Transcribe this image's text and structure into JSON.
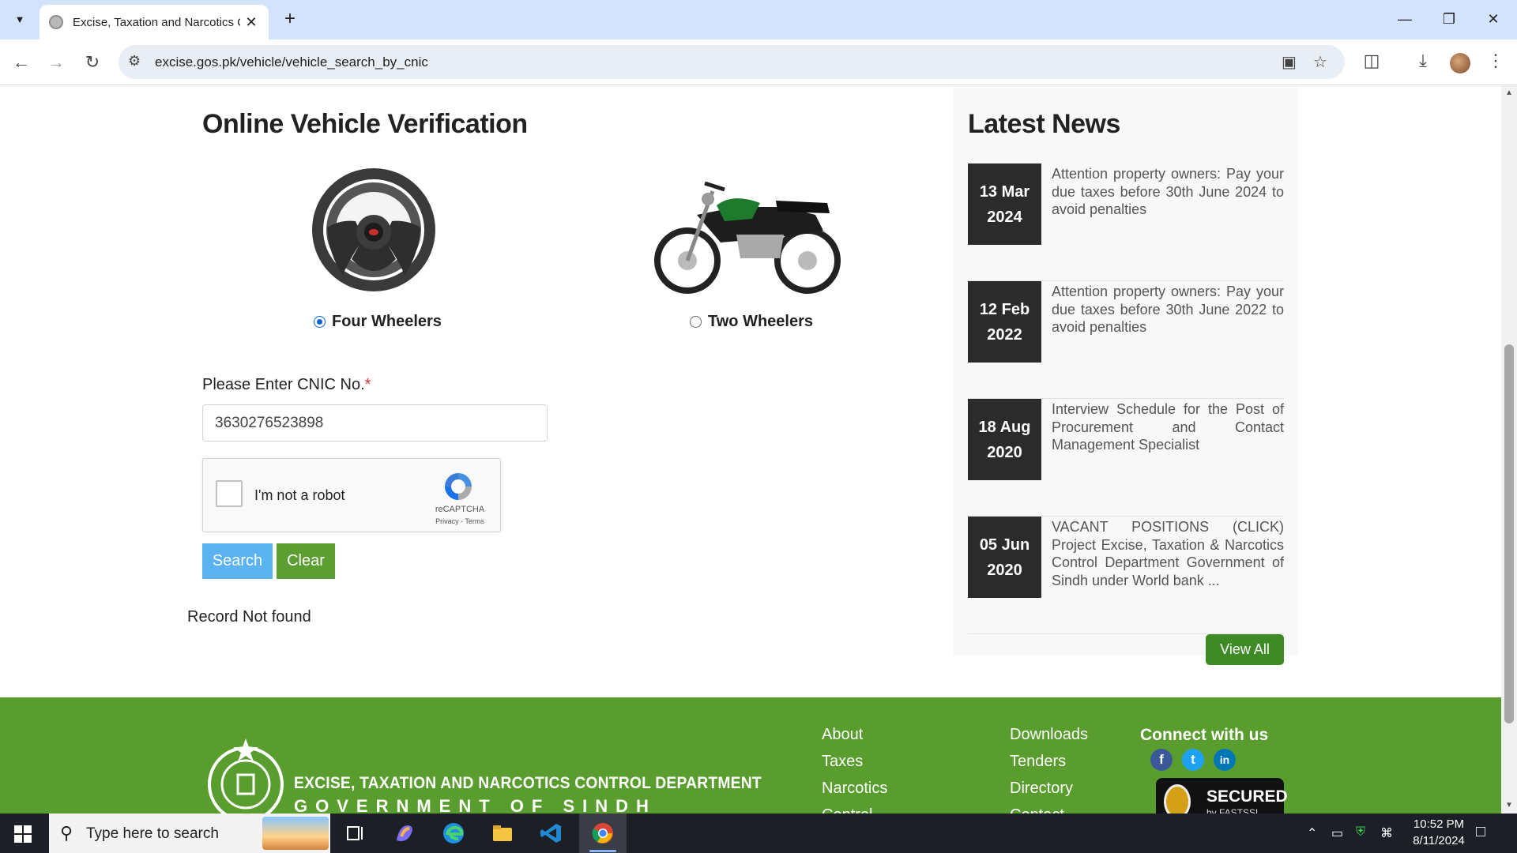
{
  "browser": {
    "tab_title": "Excise, Taxation and Narcotics C",
    "url": "excise.gos.pk/vehicle/vehicle_search_by_cnic"
  },
  "page": {
    "heading": "Online Vehicle Verification",
    "vehicle_types": [
      {
        "label": "Four Wheelers",
        "selected": true
      },
      {
        "label": "Two Wheelers",
        "selected": false
      }
    ],
    "cnic_label": "Please Enter CNIC No.",
    "required_mark": "*",
    "cnic_value": "3630276523898",
    "captcha": {
      "label": "I'm not a robot",
      "brand": "reCAPTCHA",
      "links": "Privacy - Terms"
    },
    "search_button": "Search",
    "clear_button": "Clear",
    "result_message": "Record Not found"
  },
  "news": {
    "title": "Latest News",
    "items": [
      {
        "day": "13 Mar",
        "year": "2024",
        "text": "Attention property owners: Pay your due taxes before 30th June 2024 to avoid penalties"
      },
      {
        "day": "12 Feb",
        "year": "2022",
        "text": "Attention property owners: Pay your due taxes before 30th June 2022 to avoid penalties"
      },
      {
        "day": "18 Aug",
        "year": "2020",
        "text": "Interview Schedule for the Post of Procurement and Contact Management Specialist"
      },
      {
        "day": "05 Jun",
        "year": "2020",
        "text": "VACANT POSITIONS (CLICK) Project Excise, Taxation & Narcotics Control Department Government of Sindh under World bank ..."
      }
    ],
    "view_all": "View All"
  },
  "footer": {
    "dept_name": "EXCISE, TAXATION AND NARCOTICS CONTROL DEPARTMENT",
    "gov_name": "GOVERNMENT OF SINDH",
    "links_col1": [
      "About",
      "Taxes",
      "Narcotics",
      "Control"
    ],
    "links_col2": [
      "Downloads",
      "Tenders",
      "Directory",
      "Contact"
    ],
    "connect_title": "Connect with us",
    "social": [
      "f",
      "t",
      "in"
    ],
    "ssl_text": "SECURED",
    "ssl_sub": "by FASTSSL"
  },
  "taskbar": {
    "search_placeholder": "Type here to search",
    "time": "10:52 PM",
    "date": "8/11/2024"
  },
  "colors": {
    "footer_green": "#599d2e",
    "search_blue": "#5ab2f0",
    "clear_green": "#5c9e31",
    "date_box": "#2b2b2b"
  }
}
